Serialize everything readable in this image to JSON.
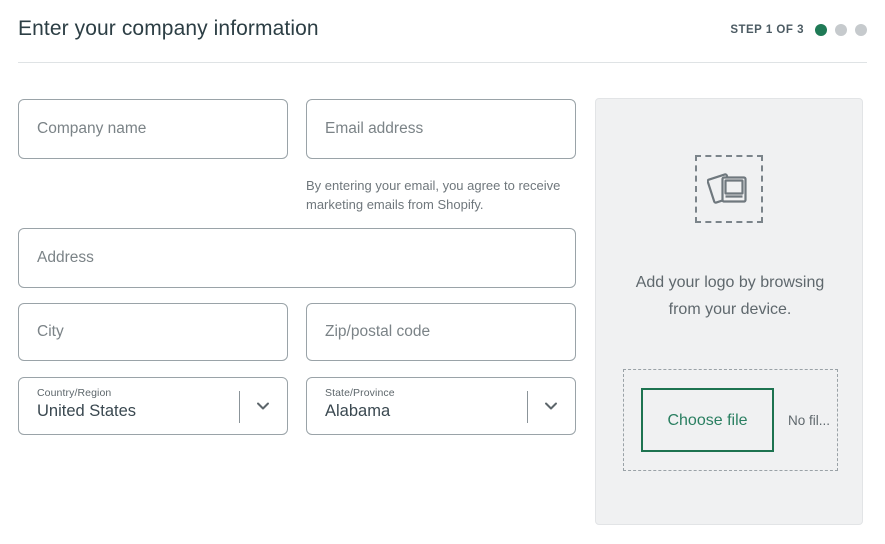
{
  "header": {
    "title": "Enter your company information",
    "step_label": "STEP 1 OF 3",
    "step_current": 1,
    "step_total": 3,
    "active_color": "#1f7a56",
    "inactive_color": "#c6cacd"
  },
  "form": {
    "company": {
      "placeholder": "Company name",
      "value": ""
    },
    "email": {
      "placeholder": "Email address",
      "value": ""
    },
    "email_helper": "By entering your email, you agree to receive marketing emails from Shopify.",
    "address": {
      "placeholder": "Address",
      "value": ""
    },
    "city": {
      "placeholder": "City",
      "value": ""
    },
    "zip": {
      "placeholder": "Zip/postal code",
      "value": ""
    },
    "country": {
      "label": "Country/Region",
      "value": "United States",
      "icon": "chevron-down-icon"
    },
    "state": {
      "label": "State/Province",
      "value": "Alabama",
      "icon": "chevron-down-icon"
    }
  },
  "logo_panel": {
    "icon": "photos-upload-icon",
    "caption": "Add your logo by browsing from your device.",
    "choose_file_label": "Choose file",
    "no_file_text": "No fil...",
    "accent_color": "#1d7350",
    "panel_bg": "#f0f1f2"
  }
}
